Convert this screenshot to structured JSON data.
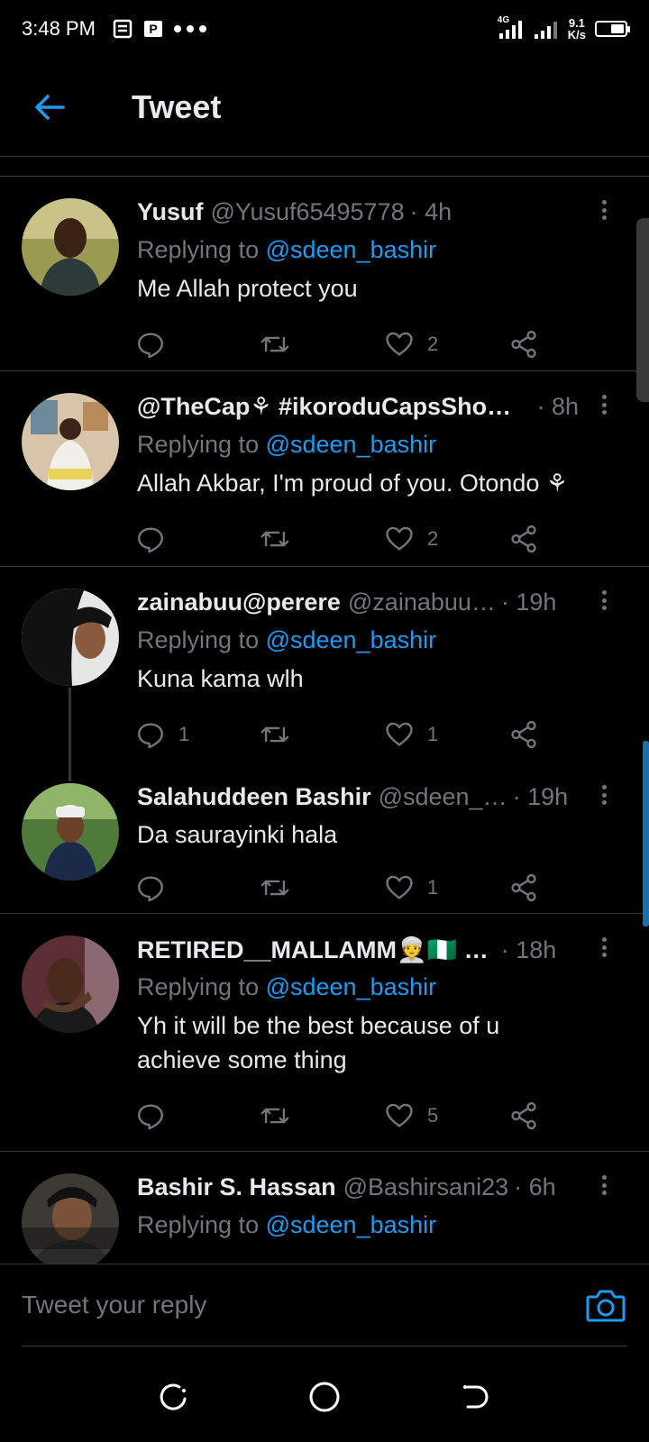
{
  "status_bar": {
    "time": "3:48 PM",
    "left_icons": [
      "notes-icon",
      "parking-icon",
      "more-dots-icon"
    ],
    "network": "4G",
    "speed_value": "9.1",
    "speed_unit": "K/s"
  },
  "header": {
    "title": "Tweet",
    "back_icon": "back-arrow-icon",
    "accent": "#1d9bf0"
  },
  "tweets": [
    {
      "name": "Yusuf",
      "handle": "@Yusuf65495778",
      "time": "· 4h",
      "replying_prefix": "Replying to ",
      "replying_handle": "@sdeen_bashir",
      "text": "Me Allah protect you",
      "reply_count": "",
      "retweet_count": "",
      "like_count": "2"
    },
    {
      "name": "@TheCap⚘ #ikoroduCapsShop …",
      "handle": "",
      "time": "· 8h",
      "replying_prefix": "Replying to ",
      "replying_handle": "@sdeen_bashir",
      "text": "Allah Akbar,  I'm proud of you. Otondo ⚘",
      "reply_count": "",
      "retweet_count": "",
      "like_count": "2"
    },
    {
      "name": "zainabuu@perere",
      "handle": "@zainabuu…",
      "time": "· 19h",
      "replying_prefix": "Replying to ",
      "replying_handle": "@sdeen_bashir",
      "text": "Kuna kama wlh",
      "reply_count": "1",
      "retweet_count": "",
      "like_count": "1"
    },
    {
      "name": "Salahuddeen Bashir",
      "handle": "@sdeen_…",
      "time": "· 19h",
      "text": "Da saurayinki hala",
      "reply_count": "",
      "retweet_count": "",
      "like_count": "1"
    },
    {
      "name": "RETIRED__MALLAMM👳🇳🇬 …",
      "handle": "",
      "time": "· 18h",
      "replying_prefix": "Replying to ",
      "replying_handle": "@sdeen_bashir",
      "text": "Yh it will be the best because of u achieve some thing",
      "reply_count": "",
      "retweet_count": "",
      "like_count": "5"
    },
    {
      "name": "Bashir S. Hassan",
      "handle": "@Bashirsani23",
      "time": "· 6h",
      "replying_prefix": "Replying to ",
      "replying_handle": "@sdeen_bashir",
      "text": ""
    }
  ],
  "reply_bar": {
    "placeholder": "Tweet your reply",
    "camera_icon": "camera-icon"
  },
  "navbar": {
    "icons": [
      "recent-apps-icon",
      "home-icon",
      "back-icon"
    ]
  }
}
